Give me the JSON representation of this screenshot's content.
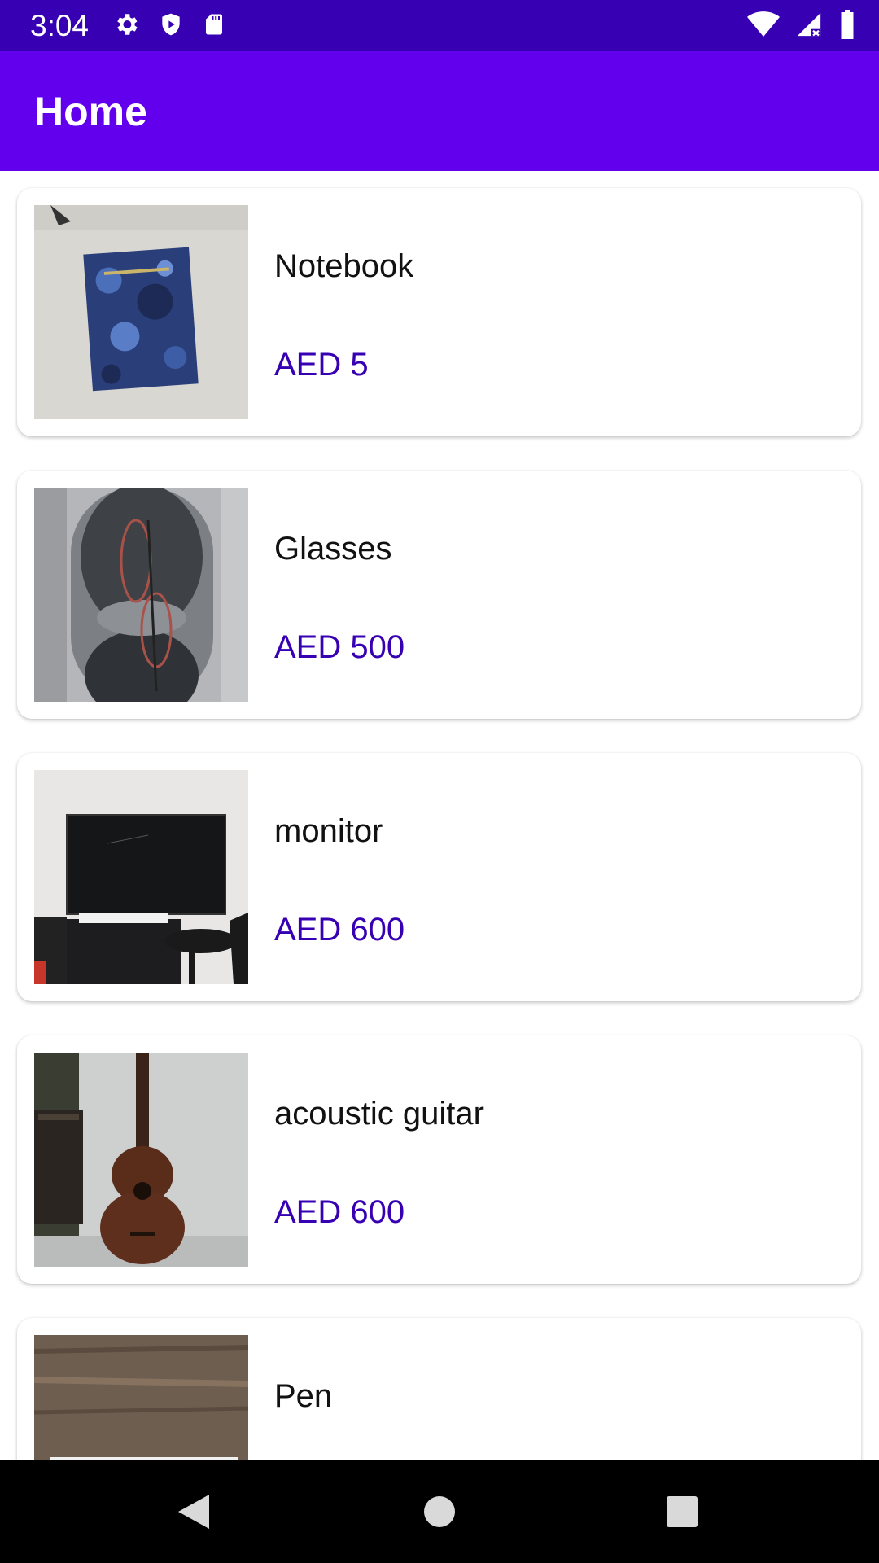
{
  "status_bar": {
    "time": "3:04",
    "left_icons": [
      "gear-icon",
      "shield-icon",
      "sd-card-icon"
    ],
    "right_icons": [
      "wifi-icon",
      "signal-icon",
      "battery-icon"
    ]
  },
  "app_bar": {
    "title": "Home"
  },
  "items": [
    {
      "name": "Notebook",
      "price": "AED 5",
      "image": "notebook-photo"
    },
    {
      "name": "Glasses",
      "price": "AED 500",
      "image": "glasses-photo"
    },
    {
      "name": "monitor",
      "price": "AED 600",
      "image": "monitor-photo"
    },
    {
      "name": "acoustic guitar",
      "price": "AED 600",
      "image": "guitar-photo"
    },
    {
      "name": "Pen",
      "price": "",
      "image": "pen-photo"
    }
  ],
  "nav_bar": {
    "buttons": [
      "back-icon",
      "home-icon",
      "recents-icon"
    ]
  },
  "colors": {
    "status_bar": "#3700b3",
    "app_bar": "#6200ee",
    "price": "#3700b3",
    "nav_bar": "#000000"
  }
}
